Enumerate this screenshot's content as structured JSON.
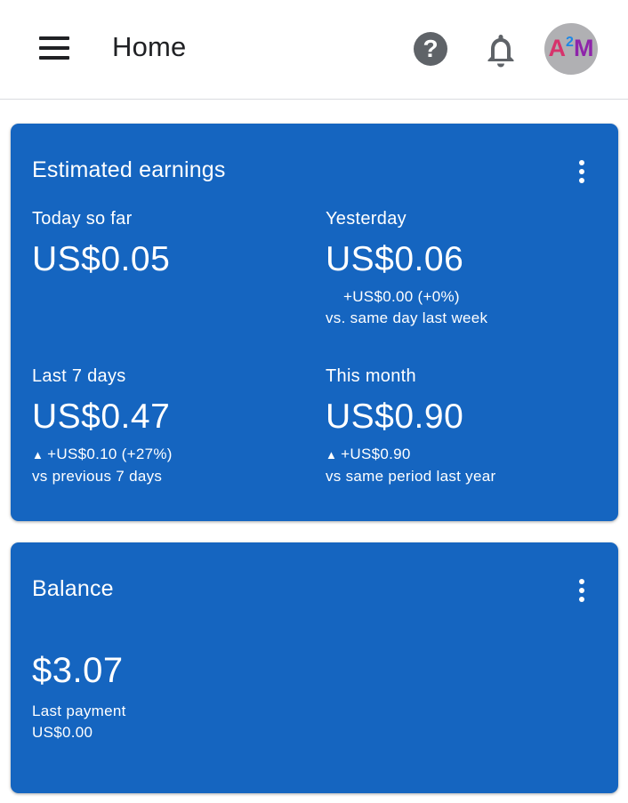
{
  "header": {
    "menu_icon": "hamburger-menu-icon",
    "title": "Home",
    "help_icon": "help-circle-icon",
    "notifications_icon": "bell-icon",
    "avatar": {
      "a": "A",
      "sup": "2",
      "m": "M"
    }
  },
  "earnings": {
    "title": "Estimated earnings",
    "more_icon": "more-vert-icon",
    "today": {
      "label": "Today so far",
      "value": "US$0.05"
    },
    "yesterday": {
      "label": "Yesterday",
      "value": "US$0.06",
      "change": "+US$0.00 (+0%)",
      "compare": "vs. same day last week"
    },
    "last7": {
      "label": "Last 7 days",
      "value": "US$0.47",
      "arrow": "▲",
      "change": "+US$0.10 (+27%)",
      "compare": "vs previous 7 days"
    },
    "month": {
      "label": "This month",
      "value": "US$0.90",
      "arrow": "▲",
      "change": "+US$0.90",
      "compare": "vs same period last year"
    }
  },
  "balance": {
    "title": "Balance",
    "more_icon": "more-vert-icon",
    "amount": "$3.07",
    "last_payment_label": "Last payment",
    "last_payment_value": "US$0.00"
  },
  "colors": {
    "card_blue": "#1565c0",
    "text_dark": "#202124",
    "icon_gray": "#5f6368"
  }
}
